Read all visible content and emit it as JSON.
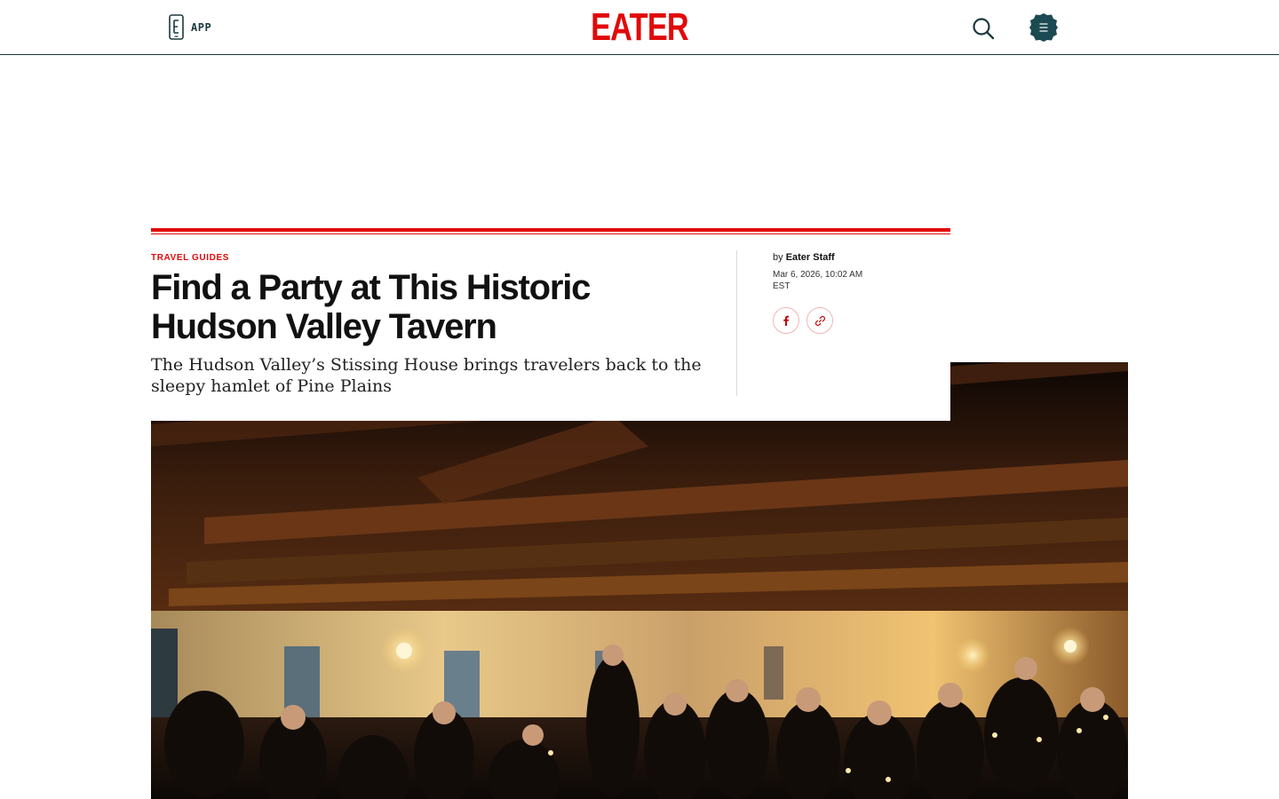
{
  "nav": {
    "app_label": "APP",
    "logo_text": "EATER",
    "brand_color": "#e10a0a",
    "nav_color": "#1b3a3f",
    "search_icon": "search-icon",
    "menu_icon": "hamburger-menu-icon"
  },
  "article": {
    "kicker": "TRAVEL GUIDES",
    "headline": "Find a Party at This Historic Hudson Valley Tavern",
    "dek": "The Hudson Valley’s Stissing House brings travelers back to the sleepy hamlet of Pine Plains",
    "byline_prefix": "by",
    "author": "Eater Staff",
    "date": "Mar 6, 2026, 10:02 AM EST",
    "share_icons": [
      "facebook-icon",
      "link-icon"
    ]
  },
  "hero": {
    "image_icon": "hero-photo"
  }
}
